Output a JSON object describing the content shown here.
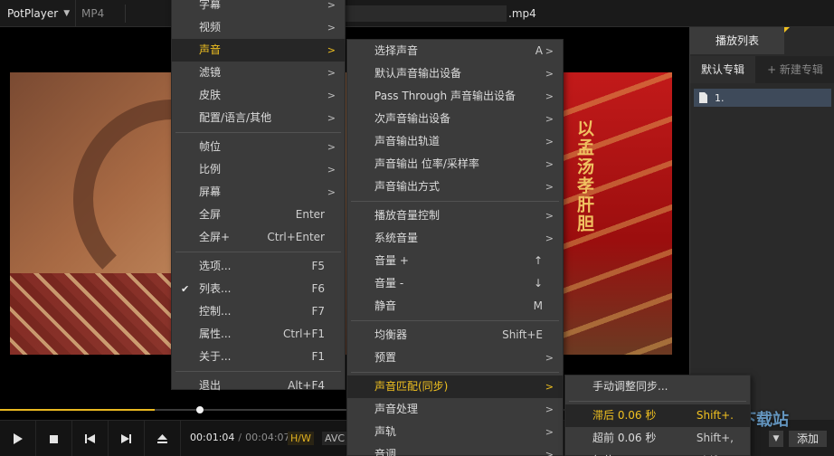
{
  "titlebar": {
    "app": "PotPlayer",
    "format": "MP4",
    "filename": ".mp4"
  },
  "video": {
    "calligraphy": "以孟汤孝肝胆"
  },
  "menu1": {
    "items": [
      {
        "label": "字幕",
        "arrow": ">"
      },
      {
        "label": "视频",
        "arrow": ">"
      },
      {
        "label": "声音",
        "arrow": ">",
        "selected": true
      },
      {
        "label": "滤镜",
        "arrow": ">"
      },
      {
        "label": "皮肤",
        "arrow": ">"
      },
      {
        "label": "配置/语言/其他",
        "arrow": ">"
      },
      {
        "sep": true
      },
      {
        "label": "帧位",
        "arrow": ">"
      },
      {
        "label": "比例",
        "arrow": ">"
      },
      {
        "label": "屏幕",
        "arrow": ">"
      },
      {
        "label": "全屏",
        "shortcut": "Enter"
      },
      {
        "label": "全屏+",
        "shortcut": "Ctrl+Enter"
      },
      {
        "sep": true
      },
      {
        "label": "选项...",
        "shortcut": "F5"
      },
      {
        "label": "列表...",
        "shortcut": "F6",
        "checked": true
      },
      {
        "label": "控制...",
        "shortcut": "F7"
      },
      {
        "label": "属性...",
        "shortcut": "Ctrl+F1"
      },
      {
        "label": "关于...",
        "shortcut": "F1"
      },
      {
        "sep": true
      },
      {
        "label": "退出",
        "shortcut": "Alt+F4"
      }
    ]
  },
  "menu2": {
    "items": [
      {
        "label": "选择声音",
        "shortcut": "A",
        "arrow": ">"
      },
      {
        "label": "默认声音输出设备",
        "arrow": ">"
      },
      {
        "label": "Pass Through 声音输出设备",
        "arrow": ">"
      },
      {
        "label": "次声音输出设备",
        "arrow": ">"
      },
      {
        "label": "声音输出轨道",
        "arrow": ">"
      },
      {
        "label": "声音输出 位率/采样率",
        "arrow": ">"
      },
      {
        "label": "声音输出方式",
        "arrow": ">"
      },
      {
        "sep": true
      },
      {
        "label": "播放音量控制",
        "arrow": ">"
      },
      {
        "label": "系统音量",
        "arrow": ">"
      },
      {
        "label": "音量 +",
        "shortcut": "↑"
      },
      {
        "label": "音量 -",
        "shortcut": "↓"
      },
      {
        "label": "静音",
        "shortcut": "M"
      },
      {
        "sep": true
      },
      {
        "label": "均衡器",
        "shortcut": "Shift+E"
      },
      {
        "label": "预置",
        "arrow": ">"
      },
      {
        "sep": true
      },
      {
        "label": "声音匹配(同步)",
        "arrow": ">",
        "selected": true
      },
      {
        "label": "声音处理",
        "arrow": ">"
      },
      {
        "label": "声轨",
        "arrow": ">"
      },
      {
        "label": "音调",
        "arrow": ">"
      }
    ]
  },
  "menu3": {
    "items": [
      {
        "label": "手动调整同步..."
      },
      {
        "sep": true
      },
      {
        "label": "滞后 0.06 秒",
        "shortcut": "Shift+.",
        "highlighted": true
      },
      {
        "label": "超前 0.06 秒",
        "shortcut": "Shift+,"
      },
      {
        "label": "复位",
        "shortcut": "Shift+/",
        "checked": true
      }
    ]
  },
  "playlist": {
    "tab": "播放列表",
    "default_album": "默认专辑",
    "new_album": "+ 新建专辑",
    "item": "1.",
    "add_label": "添加"
  },
  "controls": {
    "current_time": "00:01:04",
    "total_time": "00:04:07",
    "hw": "H/W",
    "codec": "AVC",
    "progress": 0.225
  },
  "watermark": "极光下载站",
  "colors": {
    "accent": "#f0c020",
    "menu_bg": "#3b3b3b",
    "seek_fill": "#e8b820"
  }
}
